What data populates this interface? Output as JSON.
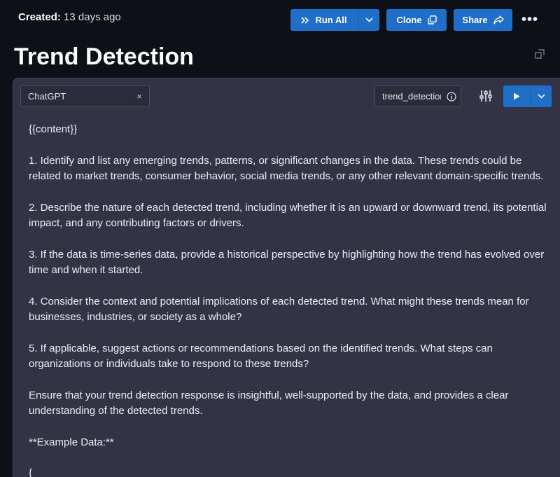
{
  "header": {
    "created_label": "Created:",
    "created_value": "13 days ago",
    "title": "Trend Detection"
  },
  "toolbar": {
    "run_all_label": "Run All",
    "clone_label": "Clone",
    "share_label": "Share",
    "more_label": "•••"
  },
  "editor": {
    "model": "ChatGPT",
    "clear_symbol": "×",
    "variable_name": "trend_detection",
    "paragraphs": [
      "{{content}}",
      "1. Identify and list any emerging trends, patterns, or significant changes in the data. These trends could be related to market trends, consumer behavior, social media trends, or any other relevant domain-specific trends.",
      "2. Describe the nature of each detected trend, including whether it is an upward or downward trend, its potential impact, and any contributing factors or drivers.",
      "3. If the data is time-series data, provide a historical perspective by highlighting how the trend has evolved over time and when it started.",
      "4. Consider the context and potential implications of each detected trend. What might these trends mean for businesses, industries, or society as a whole?",
      "5. If applicable, suggest actions or recommendations based on the identified trends. What steps can organizations or individuals take to respond to these trends?",
      "Ensure that your trend detection response is insightful, well-supported by the data, and provides a clear understanding of the detected trends.",
      "**Example Data:**",
      "{"
    ]
  },
  "colors": {
    "background": "#0d1017",
    "card": "#323446",
    "accent": "#1f6fc9"
  },
  "icons": [
    "double-chevron-right-icon",
    "chevron-down-icon",
    "copy-icon",
    "share-arrow-icon",
    "more-icon",
    "expand-icon",
    "clear-icon",
    "info-icon",
    "sliders-icon",
    "play-icon"
  ]
}
